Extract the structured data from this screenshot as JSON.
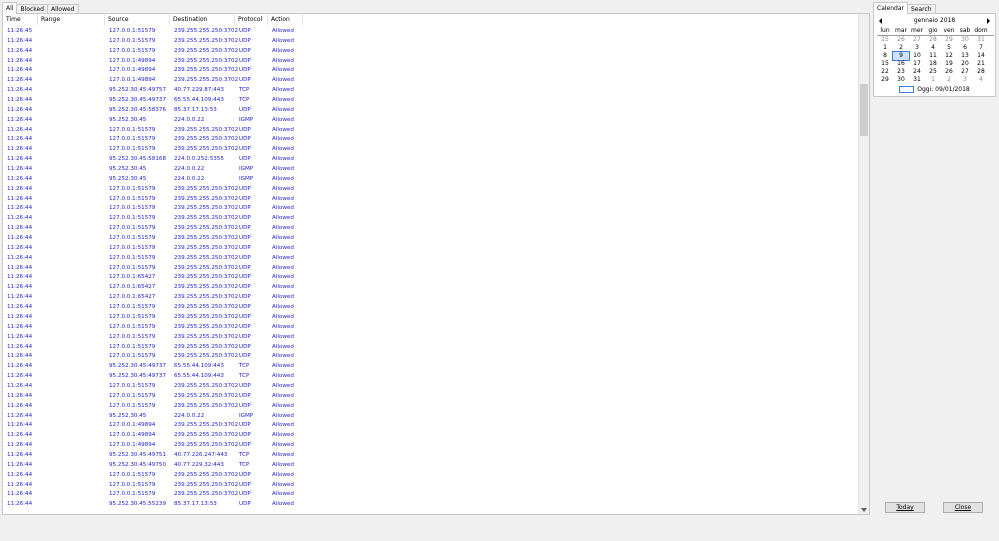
{
  "tabs": [
    "All",
    "Blocked",
    "Allowed"
  ],
  "columns": [
    "Time",
    "Range",
    "Source",
    "Destination",
    "Protocol",
    "Action"
  ],
  "rows": [
    [
      "11:26:45",
      "",
      "127.0.0.1:51579",
      "239.255.255.250:3702",
      "UDP",
      "Allowed"
    ],
    [
      "11:26:44",
      "",
      "127.0.0.1:51579",
      "239.255.255.250:3702",
      "UDP",
      "Allowed"
    ],
    [
      "11:26:44",
      "",
      "127.0.0.1:51579",
      "239.255.255.250:3702",
      "UDP",
      "Allowed"
    ],
    [
      "11:26:44",
      "",
      "127.0.0.1:49894",
      "239.255.255.250:3702",
      "UDP",
      "Allowed"
    ],
    [
      "11:26:44",
      "",
      "127.0.0.1:49894",
      "239.255.255.250:3702",
      "UDP",
      "Allowed"
    ],
    [
      "11:26:44",
      "",
      "127.0.0.1:49894",
      "239.255.255.250:3702",
      "UDP",
      "Allowed"
    ],
    [
      "11:26:44",
      "",
      "95.252.30.45:49757",
      "40.77.229.87:443",
      "TCP",
      "Allowed"
    ],
    [
      "11:26:44",
      "",
      "95.252.30.45:49737",
      "65.55.44.109:443",
      "TCP",
      "Allowed"
    ],
    [
      "11:26:44",
      "",
      "95.252.30.45:58376",
      "85.37.17.13:53",
      "UDP",
      "Allowed"
    ],
    [
      "11:26:44",
      "",
      "95.252.30.45",
      "224.0.0.22",
      "IGMP",
      "Allowed"
    ],
    [
      "11:26:44",
      "",
      "127.0.0.1:51579",
      "239.255.255.250:3702",
      "UDP",
      "Allowed"
    ],
    [
      "11:26:44",
      "",
      "127.0.0.1:51579",
      "239.255.255.250:3702",
      "UDP",
      "Allowed"
    ],
    [
      "11:26:44",
      "",
      "127.0.0.1:51579",
      "239.255.255.250:3702",
      "UDP",
      "Allowed"
    ],
    [
      "11:26:44",
      "",
      "95.252.30.45:58168",
      "224.0.0.252:5355",
      "UDP",
      "Allowed"
    ],
    [
      "11:26:44",
      "",
      "95.252.30.45",
      "224.0.0.22",
      "IGMP",
      "Allowed"
    ],
    [
      "11:26:44",
      "",
      "95.252.30.45",
      "224.0.0.22",
      "IGMP",
      "Allowed"
    ],
    [
      "11:26:44",
      "",
      "127.0.0.1:51579",
      "239.255.255.250:3702",
      "UDP",
      "Allowed"
    ],
    [
      "11:26:44",
      "",
      "127.0.0.1:51579",
      "239.255.255.250:3702",
      "UDP",
      "Allowed"
    ],
    [
      "11:26:44",
      "",
      "127.0.0.1:51579",
      "239.255.255.250:3702",
      "UDP",
      "Allowed"
    ],
    [
      "11:26:44",
      "",
      "127.0.0.1:51579",
      "239.255.255.250:3702",
      "UDP",
      "Allowed"
    ],
    [
      "11:26:44",
      "",
      "127.0.0.1:51579",
      "239.255.255.250:3702",
      "UDP",
      "Allowed"
    ],
    [
      "11:26:44",
      "",
      "127.0.0.1:51579",
      "239.255.255.250:3702",
      "UDP",
      "Allowed"
    ],
    [
      "11:26:44",
      "",
      "127.0.0.1:51579",
      "239.255.255.250:3702",
      "UDP",
      "Allowed"
    ],
    [
      "11:26:44",
      "",
      "127.0.0.1:51579",
      "239.255.255.250:3702",
      "UDP",
      "Allowed"
    ],
    [
      "11:26:44",
      "",
      "127.0.0.1:51579",
      "239.255.255.250:3702",
      "UDP",
      "Allowed"
    ],
    [
      "11:26:44",
      "",
      "127.0.0.1:65427",
      "239.255.255.250:3702",
      "UDP",
      "Allowed"
    ],
    [
      "11:26:44",
      "",
      "127.0.0.1:65427",
      "239.255.255.250:3702",
      "UDP",
      "Allowed"
    ],
    [
      "11:26:44",
      "",
      "127.0.0.1:65427",
      "239.255.255.250:3702",
      "UDP",
      "Allowed"
    ],
    [
      "11:26:44",
      "",
      "127.0.0.1:51579",
      "239.255.255.250:3702",
      "UDP",
      "Allowed"
    ],
    [
      "11:26:44",
      "",
      "127.0.0.1:51579",
      "239.255.255.250:3702",
      "UDP",
      "Allowed"
    ],
    [
      "11:26:44",
      "",
      "127.0.0.1:51579",
      "239.255.255.250:3702",
      "UDP",
      "Allowed"
    ],
    [
      "11:26:44",
      "",
      "127.0.0.1:51579",
      "239.255.255.250:3702",
      "UDP",
      "Allowed"
    ],
    [
      "11:26:44",
      "",
      "127.0.0.1:51579",
      "239.255.255.250:3702",
      "UDP",
      "Allowed"
    ],
    [
      "11:26:44",
      "",
      "127.0.0.1:51579",
      "239.255.255.250:3702",
      "UDP",
      "Allowed"
    ],
    [
      "11:26:44",
      "",
      "95.252.30.45:49737",
      "65.55.44.109:443",
      "TCP",
      "Allowed"
    ],
    [
      "11:26:44",
      "",
      "95.252.30.45:49737",
      "65.55.44.109:443",
      "TCP",
      "Allowed"
    ],
    [
      "11:26:44",
      "",
      "127.0.0.1:51579",
      "239.255.255.250:3702",
      "UDP",
      "Allowed"
    ],
    [
      "11:26:44",
      "",
      "127.0.0.1:51579",
      "239.255.255.250:3702",
      "UDP",
      "Allowed"
    ],
    [
      "11:26:44",
      "",
      "127.0.0.1:51579",
      "239.255.255.250:3702",
      "UDP",
      "Allowed"
    ],
    [
      "11:26:44",
      "",
      "95.252.30.45",
      "224.0.0.22",
      "IGMP",
      "Allowed"
    ],
    [
      "11:26:44",
      "",
      "127.0.0.1:49894",
      "239.255.255.250:3702",
      "UDP",
      "Allowed"
    ],
    [
      "11:26:44",
      "",
      "127.0.0.1:49894",
      "239.255.255.250:3702",
      "UDP",
      "Allowed"
    ],
    [
      "11:26:44",
      "",
      "127.0.0.1:49894",
      "239.255.255.250:3702",
      "UDP",
      "Allowed"
    ],
    [
      "11:26:44",
      "",
      "95.252.30.45:49751",
      "40.77.226.247:443",
      "TCP",
      "Allowed"
    ],
    [
      "11:26:44",
      "",
      "95.252.30.45:49750",
      "40.77.229.32:443",
      "TCP",
      "Allowed"
    ],
    [
      "11:26:44",
      "",
      "127.0.0.1:51579",
      "239.255.255.250:3702",
      "UDP",
      "Allowed"
    ],
    [
      "11:26:44",
      "",
      "127.0.0.1:51579",
      "239.255.255.250:3702",
      "UDP",
      "Allowed"
    ],
    [
      "11:26:44",
      "",
      "127.0.0.1:51579",
      "239.255.255.250:3702",
      "UDP",
      "Allowed"
    ],
    [
      "11:26:44",
      "",
      "95.252.30.45:55239",
      "85.37.17.13:53",
      "UDP",
      "Allowed"
    ]
  ],
  "right_tabs": [
    "Calendar",
    "Search"
  ],
  "calendar": {
    "month_label": "gennaio 2018",
    "weekdays": [
      "lun",
      "mar",
      "mer",
      "gio",
      "ven",
      "sab",
      "dom"
    ],
    "weeks": [
      [
        "25",
        "26",
        "27",
        "28",
        "29",
        "30",
        "31"
      ],
      [
        "1",
        "2",
        "3",
        "4",
        "5",
        "6",
        "7"
      ],
      [
        "8",
        "9",
        "10",
        "11",
        "12",
        "13",
        "14"
      ],
      [
        "15",
        "16",
        "17",
        "18",
        "19",
        "20",
        "21"
      ],
      [
        "22",
        "23",
        "24",
        "25",
        "26",
        "27",
        "28"
      ],
      [
        "29",
        "30",
        "31",
        "1",
        "2",
        "3",
        "4"
      ]
    ],
    "gray_first_row": true,
    "gray_last_row_from": 3,
    "selected": "9",
    "today_label": "Oggi: 09/01/2018"
  },
  "buttons": {
    "today": "Today",
    "close": "Close"
  }
}
